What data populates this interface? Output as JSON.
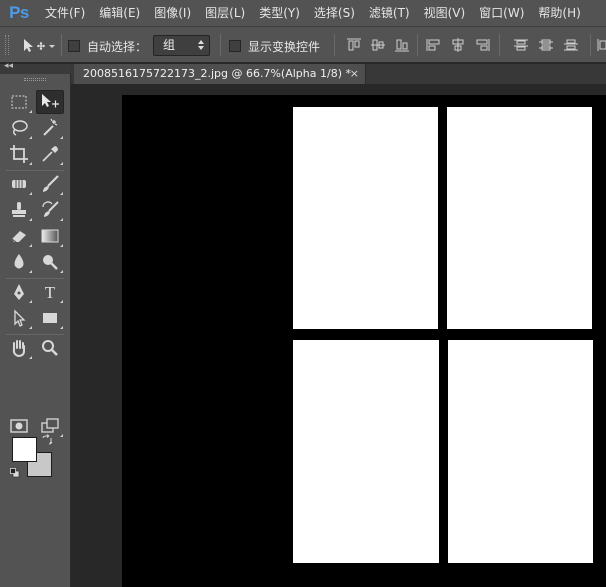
{
  "app": {
    "logo": "Ps",
    "menu": [
      "文件(F)",
      "编辑(E)",
      "图像(I)",
      "图层(L)",
      "类型(Y)",
      "选择(S)",
      "滤镜(T)",
      "视图(V)",
      "窗口(W)",
      "帮助(H)"
    ]
  },
  "options": {
    "tool_icon": "move-tool-icon",
    "auto_select_label": "自动选择：",
    "auto_select_checked": false,
    "auto_select_value": "组",
    "show_transform_label": "显示变换控件",
    "show_transform_checked": false
  },
  "document": {
    "tab_title": "2008516175722173_2.jpg @ 66.7%(Alpha 1/8) *",
    "close_glyph": "×"
  },
  "colors": {
    "foreground": "#ffffff",
    "background": "#c8c8c8",
    "canvas": "#000000",
    "accent": "#4d9be6"
  },
  "tools": [
    "rectangular-marquee-icon",
    "move-tool-icon",
    "lasso-icon",
    "magic-wand-icon",
    "crop-icon",
    "eyedropper-icon",
    "healing-brush-icon",
    "brush-icon",
    "clone-stamp-icon",
    "history-brush-icon",
    "eraser-icon",
    "gradient-icon",
    "blur-icon",
    "dodge-icon",
    "pen-icon",
    "type-icon",
    "path-selection-icon",
    "rectangle-shape-icon",
    "hand-icon",
    "zoom-icon",
    "quick-mask-icon",
    "screen-mode-icon"
  ],
  "tool_glyphs": {
    "type": "T"
  }
}
